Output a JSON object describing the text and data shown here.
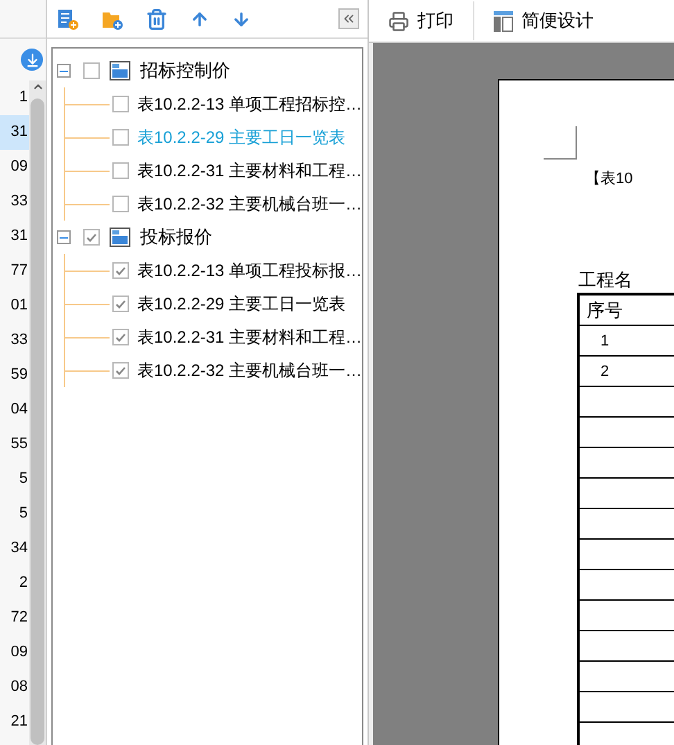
{
  "left_list": {
    "rows": [
      {
        "text": "1",
        "selected": false
      },
      {
        "text": "31",
        "selected": true
      },
      {
        "text": "09",
        "selected": false
      },
      {
        "text": "33",
        "selected": false
      },
      {
        "text": "31",
        "selected": false
      },
      {
        "text": "77",
        "selected": false
      },
      {
        "text": "01",
        "selected": false
      },
      {
        "text": "33",
        "selected": false
      },
      {
        "text": "59",
        "selected": false
      },
      {
        "text": "04",
        "selected": false
      },
      {
        "text": "55",
        "selected": false
      },
      {
        "text": "5",
        "selected": false
      },
      {
        "text": "5",
        "selected": false
      },
      {
        "text": "34",
        "selected": false
      },
      {
        "text": "2",
        "selected": false
      },
      {
        "text": "72",
        "selected": false
      },
      {
        "text": "09",
        "selected": false
      },
      {
        "text": "08",
        "selected": false
      },
      {
        "text": "21",
        "selected": false
      }
    ]
  },
  "tree": [
    {
      "label": "招标控制价",
      "expanded": true,
      "checked": false,
      "children": [
        {
          "label": "表10.2.2-13 单项工程招标控…",
          "checked": false,
          "selected": false
        },
        {
          "label": "表10.2.2-29 主要工日一览表",
          "checked": false,
          "selected": true
        },
        {
          "label": "表10.2.2-31 主要材料和工程…",
          "checked": false,
          "selected": false
        },
        {
          "label": "表10.2.2-32 主要机械台班一…",
          "checked": false,
          "selected": false
        }
      ]
    },
    {
      "label": "投标报价",
      "expanded": true,
      "checked": true,
      "children": [
        {
          "label": "表10.2.2-13 单项工程投标报…",
          "checked": true,
          "selected": false
        },
        {
          "label": "表10.2.2-29 主要工日一览表",
          "checked": true,
          "selected": false
        },
        {
          "label": "表10.2.2-31 主要材料和工程…",
          "checked": true,
          "selected": false
        },
        {
          "label": "表10.2.2-32 主要机械台班一…",
          "checked": true,
          "selected": false
        }
      ]
    }
  ],
  "preview_toolbar": [
    {
      "kind": "print",
      "label": "打印"
    },
    {
      "kind": "design",
      "label": "简便设计"
    }
  ],
  "document": {
    "title": "【表10",
    "project_label": "工程名",
    "columns": [
      "序号"
    ],
    "rows": [
      "1",
      "2"
    ]
  }
}
